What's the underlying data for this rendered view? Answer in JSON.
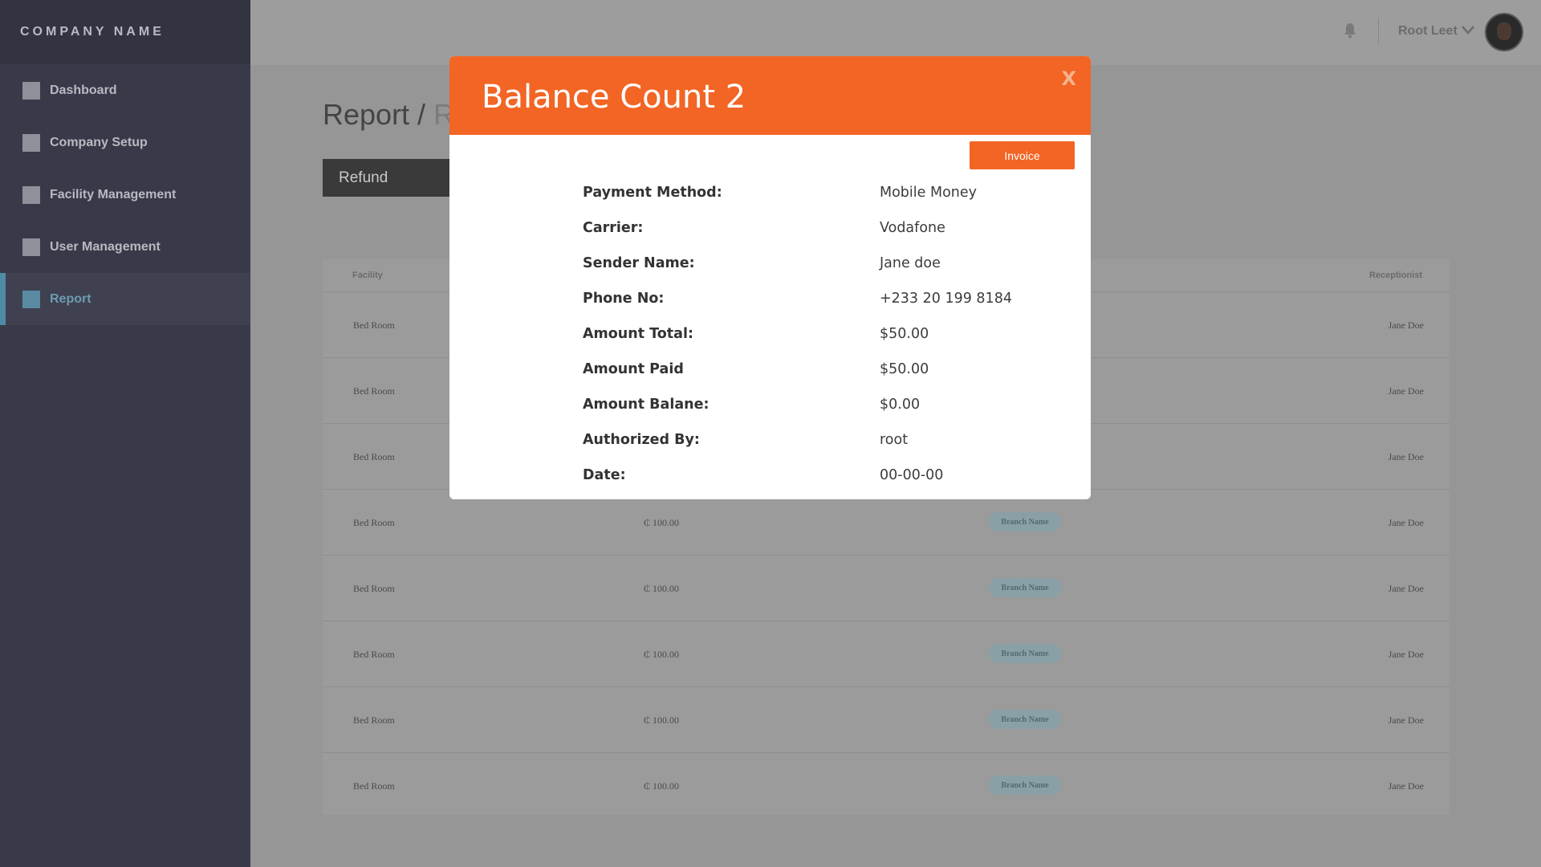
{
  "brand": "COMPANY NAME",
  "sidebar": {
    "items": [
      {
        "label": "Dashboard"
      },
      {
        "label": "Company Setup"
      },
      {
        "label": "Facility Management"
      },
      {
        "label": "User Management"
      },
      {
        "label": "Report"
      }
    ],
    "active_index": 4
  },
  "topbar": {
    "user_name": "Root Leet"
  },
  "page": {
    "title_main": "Report / ",
    "title_sub": "Re",
    "refund_label": "Refund"
  },
  "table": {
    "headers": {
      "facility": "Facility",
      "receptionist": "Receptionist"
    },
    "rows": [
      {
        "facility": "Bed Room",
        "amount": "",
        "branch": "",
        "receptionist": "Jane Doe"
      },
      {
        "facility": "Bed Room",
        "amount": "",
        "branch": "",
        "receptionist": "Jane Doe"
      },
      {
        "facility": "Bed Room",
        "amount": "",
        "branch": "",
        "receptionist": "Jane Doe"
      },
      {
        "facility": "Bed Room",
        "amount": "₵ 100.00",
        "branch": "Branch Name",
        "receptionist": "Jane Doe"
      },
      {
        "facility": "Bed Room",
        "amount": "₵ 100.00",
        "branch": "Branch Name",
        "receptionist": "Jane Doe"
      },
      {
        "facility": "Bed Room",
        "amount": "₵ 100.00",
        "branch": "Branch Name",
        "receptionist": "Jane Doe"
      },
      {
        "facility": "Bed Room",
        "amount": "₵ 100.00",
        "branch": "Branch Name",
        "receptionist": "Jane Doe"
      },
      {
        "facility": "Bed Room",
        "amount": "₵ 100.00",
        "branch": "Branch Name",
        "receptionist": "Jane Doe"
      }
    ]
  },
  "modal": {
    "title": "Balance Count 2",
    "close": "X",
    "invoice_label": "Invoice",
    "details": [
      {
        "label": "Payment Method:",
        "value": "Mobile Money"
      },
      {
        "label": "Carrier:",
        "value": "Vodafone"
      },
      {
        "label": "Sender Name:",
        "value": "Jane doe"
      },
      {
        "label": "Phone No:",
        "value": "+233 20 199 8184"
      },
      {
        "label": "Amount Total:",
        "value": "$50.00"
      },
      {
        "label": "Amount Paid",
        "value": "$50.00"
      },
      {
        "label": "Amount Balane:",
        "value": "$0.00"
      },
      {
        "label": "Authorized By:",
        "value": "root"
      },
      {
        "label": "Date:",
        "value": "00-00-00"
      }
    ]
  },
  "colors": {
    "accent": "#f26524",
    "sidebar_bg": "#393a49",
    "active_nav": "#5a8ba3"
  }
}
